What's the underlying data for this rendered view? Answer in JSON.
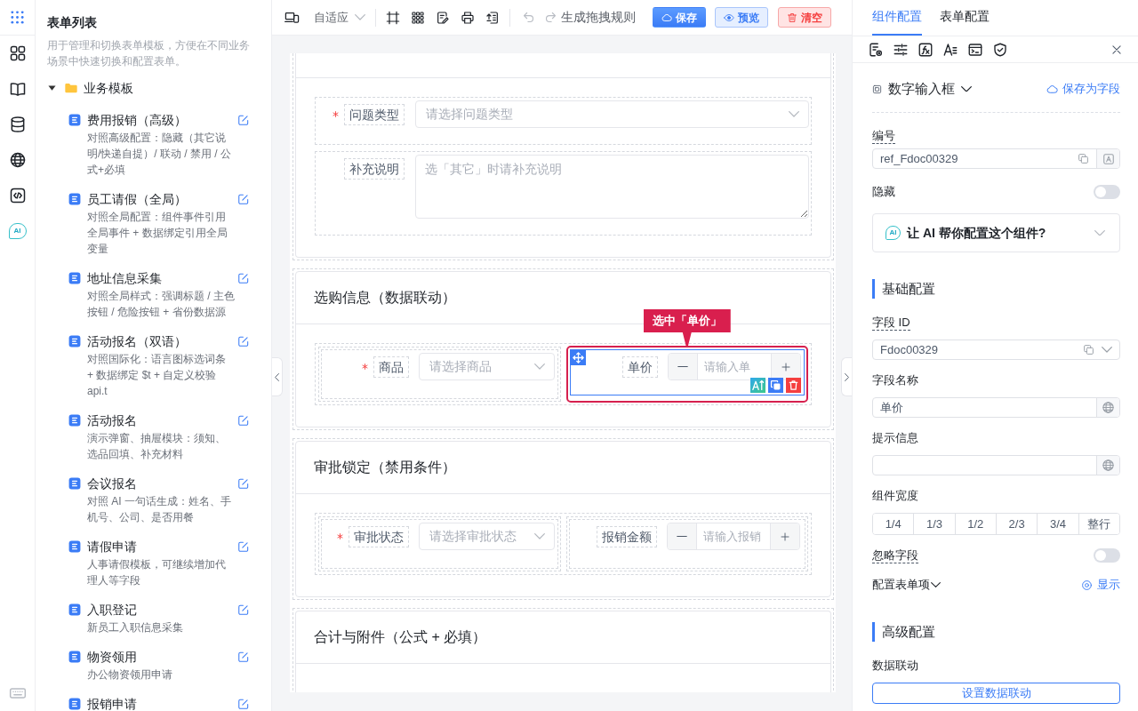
{
  "rail": {
    "ai_label": "AI"
  },
  "sidebar": {
    "title": "表单列表",
    "description": "用于管理和切换表单模板，方便在不同业务场景中快速切换和配置表单。",
    "folders": [
      {
        "label": "业务模板",
        "expanded": true,
        "children": [
          {
            "title": "费用报销（高级）",
            "description": "对照高级配置：隐藏（其它说明/快递自提）/ 联动 / 禁用 / 公式+必填",
            "selected": false
          },
          {
            "title": "员工请假（全局）",
            "description": "对照全局配置：组件事件引用全局事件 + 数据绑定引用全局变量",
            "selected": false
          },
          {
            "title": "地址信息采集",
            "description": "对照全局样式：强调标题 / 主色按钮 / 危险按钮 + 省份数据源",
            "selected": false
          },
          {
            "title": "活动报名（双语）",
            "description": "对照国际化：语言图标选词条 + 数据绑定 $t + 自定义校验 api.t",
            "selected": false
          },
          {
            "title": "活动报名",
            "description": "演示弹窗、抽屉模块：须知、选品回填、补充材料",
            "selected": false
          },
          {
            "title": "会议报名",
            "description": "对照 AI 一句话生成：姓名、手机号、公司、是否用餐",
            "selected": false
          },
          {
            "title": "请假申请",
            "description": "人事请假模板，可继续增加代理人等字段",
            "selected": false
          },
          {
            "title": "入职登记",
            "description": "新员工入职信息采集",
            "selected": false
          },
          {
            "title": "物资领用",
            "description": "办公物资领用申请",
            "selected": false
          },
          {
            "title": "报销申请",
            "selected": false
          }
        ]
      }
    ]
  },
  "toolbar": {
    "device_mode": "自适应",
    "undo": {
      "disabled": true
    },
    "redo": {
      "disabled": true
    },
    "rule_action": "生成拖拽规则",
    "buttons": [
      {
        "kind": "save",
        "label": "保存"
      },
      {
        "kind": "preview",
        "label": "预览"
      },
      {
        "kind": "clear",
        "label": "清空"
      }
    ]
  },
  "canvas": {
    "sections": [
      {
        "rows": [
          {
            "fields": [
              {
                "label": "问题类型",
                "required": true,
                "kind": "select",
                "placeholder": "请选择问题类型",
                "selected": false
              }
            ]
          },
          {
            "fields": [
              {
                "label": "补充说明",
                "required": false,
                "kind": "textarea",
                "placeholder": "选「其它」时请补充说明",
                "selected": false
              }
            ]
          }
        ]
      },
      {
        "title": "选购信息（数据联动）",
        "rows": [
          {
            "fields": [
              {
                "label": "商品",
                "required": true,
                "kind": "select",
                "placeholder": "请选择商品",
                "selected": false
              },
              {
                "label": "单价",
                "required": false,
                "kind": "number",
                "placeholder": "请输入单",
                "selected": true,
                "tooltip": "选中「单价」"
              }
            ]
          }
        ]
      },
      {
        "title": "审批锁定（禁用条件）",
        "rows": [
          {
            "fields": [
              {
                "label": "审批状态",
                "required": true,
                "kind": "select",
                "placeholder": "请选择审批状态",
                "selected": false
              },
              {
                "label": "报销金额",
                "required": false,
                "kind": "number",
                "placeholder": "请输入报销",
                "selected": false
              }
            ]
          }
        ]
      },
      {
        "title": "合计与附件（公式 + 必填）"
      }
    ]
  },
  "config_panel": {
    "tabs": [
      {
        "label": "组件配置",
        "selected": true
      },
      {
        "label": "表单配置",
        "selected": false
      }
    ],
    "component_type": "数字输入框",
    "save_as_field": "保存为字段",
    "items": [
      {
        "kind": "input",
        "label": "编号",
        "tip": true,
        "value": "ref_Fdoc00329"
      },
      {
        "kind": "toggle",
        "label": "隐藏",
        "tip": false,
        "on": false
      },
      {
        "kind": "ai",
        "badge": "AI",
        "label": "让 AI 帮你配置这个组件?",
        "expanded": false
      }
    ],
    "groups": [
      {
        "title": "基础配置",
        "items": [
          {
            "kind": "select",
            "label": "字段 ID",
            "tip": true,
            "value": "Fdoc00329"
          },
          {
            "kind": "i18n",
            "label": "字段名称",
            "tip": false,
            "value": "单价"
          },
          {
            "kind": "i18n",
            "label": "提示信息",
            "tip": false
          },
          {
            "kind": "segmented",
            "label": "组件宽度",
            "tip": false,
            "options": [
              {
                "label": "1/4",
                "selected": false
              },
              {
                "label": "1/3",
                "selected": false
              },
              {
                "label": "1/2",
                "selected": false
              },
              {
                "label": "2/3",
                "selected": false
              },
              {
                "label": "3/4",
                "selected": false
              },
              {
                "label": "整行",
                "selected": false
              }
            ]
          },
          {
            "kind": "toggle",
            "label": "忽略字段",
            "tip": true,
            "on": false
          },
          {
            "kind": "expander",
            "label": "配置表单项",
            "action": "显示"
          }
        ]
      },
      {
        "title": "高级配置",
        "items": [
          {
            "kind": "button",
            "label": "数据联动",
            "tip": false,
            "button": "设置数据联动"
          }
        ]
      }
    ]
  }
}
